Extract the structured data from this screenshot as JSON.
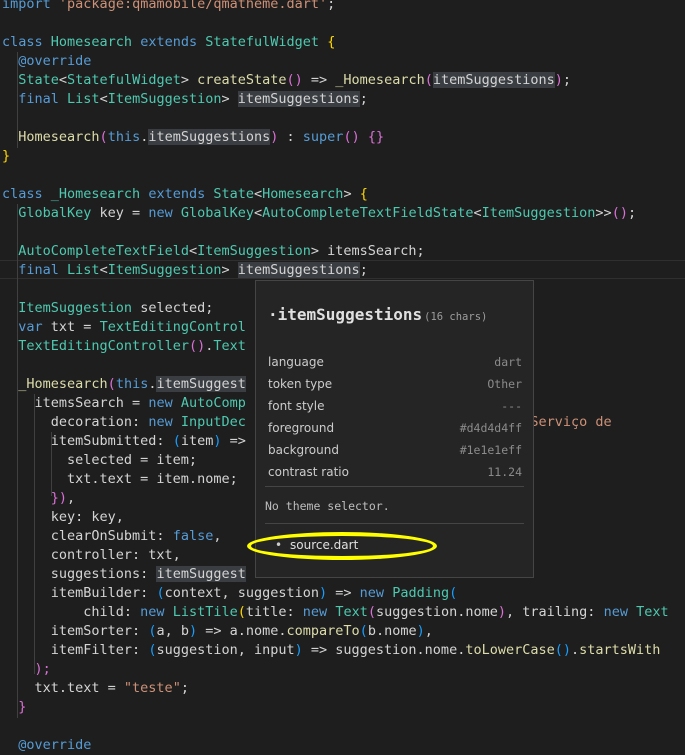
{
  "editor": {
    "lines": [
      [
        [
          "t-kw",
          "import"
        ],
        [
          "t-plain",
          " "
        ],
        [
          "t-str",
          "'package:qmamobile/qmatheme.dart'"
        ],
        [
          "t-plain",
          ";"
        ]
      ],
      [],
      [
        [
          "t-kw",
          "class"
        ],
        [
          "t-plain",
          " "
        ],
        [
          "t-cls",
          "Homesearch"
        ],
        [
          "t-plain",
          " "
        ],
        [
          "t-kw",
          "extends"
        ],
        [
          "t-plain",
          " "
        ],
        [
          "t-cls",
          "StatefulWidget"
        ],
        [
          "t-plain",
          " "
        ],
        [
          "t-brk1",
          "{"
        ]
      ],
      [
        [
          "t-plain",
          "  "
        ],
        [
          "t-ann",
          "@override"
        ]
      ],
      [
        [
          "t-plain",
          "  "
        ],
        [
          "t-cls",
          "State"
        ],
        [
          "t-plain",
          "<"
        ],
        [
          "t-cls",
          "StatefulWidget"
        ],
        [
          "t-plain",
          "> "
        ],
        [
          "t-fn",
          "createState"
        ],
        [
          "t-brk2",
          "()"
        ],
        [
          "t-plain",
          " => "
        ],
        [
          "t-fn",
          "_Homesearch"
        ],
        [
          "t-brk2",
          "("
        ],
        [
          "hl",
          "itemSuggestions"
        ],
        [
          "t-brk2",
          ")"
        ],
        [
          "t-plain",
          ";"
        ]
      ],
      [
        [
          "t-plain",
          "  "
        ],
        [
          "t-kw",
          "final"
        ],
        [
          "t-plain",
          " "
        ],
        [
          "t-cls",
          "List"
        ],
        [
          "t-plain",
          "<"
        ],
        [
          "t-cls",
          "ItemSuggestion"
        ],
        [
          "t-plain",
          "> "
        ],
        [
          "hl",
          "itemSuggestions"
        ],
        [
          "t-plain",
          ";"
        ]
      ],
      [],
      [
        [
          "t-plain",
          "  "
        ],
        [
          "t-fn",
          "Homesearch"
        ],
        [
          "t-brk2",
          "("
        ],
        [
          "t-kw",
          "this"
        ],
        [
          "t-plain",
          "."
        ],
        [
          "hl",
          "itemSuggestions"
        ],
        [
          "t-brk2",
          ")"
        ],
        [
          "t-plain",
          " : "
        ],
        [
          "t-kw",
          "super"
        ],
        [
          "t-brk2",
          "()"
        ],
        [
          "t-plain",
          " "
        ],
        [
          "t-brk2",
          "{}"
        ]
      ],
      [
        [
          "t-brk1",
          "}"
        ]
      ],
      [],
      [
        [
          "t-kw",
          "class"
        ],
        [
          "t-plain",
          " "
        ],
        [
          "t-cls",
          "_Homesearch"
        ],
        [
          "t-plain",
          " "
        ],
        [
          "t-kw",
          "extends"
        ],
        [
          "t-plain",
          " "
        ],
        [
          "t-cls",
          "State"
        ],
        [
          "t-plain",
          "<"
        ],
        [
          "t-cls",
          "Homesearch"
        ],
        [
          "t-plain",
          "> "
        ],
        [
          "t-brk1",
          "{"
        ]
      ],
      [
        [
          "t-plain",
          "  "
        ],
        [
          "t-cls",
          "GlobalKey"
        ],
        [
          "t-plain",
          " key = "
        ],
        [
          "t-kw",
          "new"
        ],
        [
          "t-plain",
          " "
        ],
        [
          "t-cls",
          "GlobalKey"
        ],
        [
          "t-plain",
          "<"
        ],
        [
          "t-cls",
          "AutoCompleteTextFieldState"
        ],
        [
          "t-plain",
          "<"
        ],
        [
          "t-cls",
          "ItemSuggestion"
        ],
        [
          "t-plain",
          ">>"
        ],
        [
          "t-brk2",
          "()"
        ],
        [
          "t-plain",
          ";"
        ]
      ],
      [],
      [
        [
          "t-plain",
          "  "
        ],
        [
          "t-cls",
          "AutoCompleteTextField"
        ],
        [
          "t-plain",
          "<"
        ],
        [
          "t-cls",
          "ItemSuggestion"
        ],
        [
          "t-plain",
          "> itemsSearch;"
        ]
      ],
      [
        [
          "t-plain",
          "  "
        ],
        [
          "t-kw",
          "final"
        ],
        [
          "t-plain",
          " "
        ],
        [
          "t-cls",
          "List"
        ],
        [
          "t-plain",
          "<"
        ],
        [
          "t-cls",
          "ItemSuggestion"
        ],
        [
          "t-plain",
          "> "
        ],
        [
          "hl",
          "itemSuggestions"
        ],
        [
          "t-plain",
          ";"
        ]
      ],
      [],
      [
        [
          "t-plain",
          "  "
        ],
        [
          "t-cls",
          "ItemSuggestion"
        ],
        [
          "t-plain",
          " selected;"
        ]
      ],
      [
        [
          "t-plain",
          "  "
        ],
        [
          "t-kw",
          "var"
        ],
        [
          "t-plain",
          " txt = "
        ],
        [
          "t-cls",
          "TextEditingControl"
        ]
      ],
      [
        [
          "t-plain",
          "  "
        ],
        [
          "t-cls",
          "TextEditingController"
        ],
        [
          "t-brk2",
          "()"
        ],
        [
          "t-plain",
          "."
        ],
        [
          "t-cls",
          "Text"
        ]
      ],
      [],
      [
        [
          "t-plain",
          "  "
        ],
        [
          "t-fn",
          "_Homesearch"
        ],
        [
          "t-brk2",
          "("
        ],
        [
          "t-kw",
          "this"
        ],
        [
          "t-plain",
          "."
        ],
        [
          "hl",
          "itemSuggest"
        ]
      ],
      [
        [
          "t-plain",
          "    itemsSearch = "
        ],
        [
          "t-kw",
          "new"
        ],
        [
          "t-plain",
          " "
        ],
        [
          "t-cls",
          "AutoComp"
        ]
      ],
      [
        [
          "t-plain",
          "      decoration: "
        ],
        [
          "t-kw",
          "new"
        ],
        [
          "t-plain",
          " "
        ],
        [
          "t-cls",
          "InputDec"
        ],
        [
          "t-plain",
          "                           "
        ],
        [
          "t-str",
          "duto ou Serviço de"
        ]
      ],
      [
        [
          "t-plain",
          "      itemSubmitted: "
        ],
        [
          "t-brk3",
          "("
        ],
        [
          "t-plain",
          "item"
        ],
        [
          "t-brk3",
          ")"
        ],
        [
          "t-plain",
          " =>"
        ]
      ],
      [
        [
          "t-plain",
          "        selected = item;"
        ]
      ],
      [
        [
          "t-plain",
          "        txt.text = item.nome;"
        ]
      ],
      [
        [
          "t-plain",
          "      "
        ],
        [
          "t-brk2",
          "})"
        ],
        [
          "t-plain",
          ","
        ]
      ],
      [
        [
          "t-plain",
          "      key: key,"
        ]
      ],
      [
        [
          "t-plain",
          "      clearOnSubmit: "
        ],
        [
          "t-bool",
          "false"
        ],
        [
          "t-plain",
          ","
        ]
      ],
      [
        [
          "t-plain",
          "      controller: txt,"
        ]
      ],
      [
        [
          "t-plain",
          "      suggestions: "
        ],
        [
          "hl",
          "itemSuggest"
        ]
      ],
      [
        [
          "t-plain",
          "      itemBuilder: "
        ],
        [
          "t-brk3",
          "("
        ],
        [
          "t-plain",
          "context, suggestion"
        ],
        [
          "t-brk3",
          ")"
        ],
        [
          "t-plain",
          " => "
        ],
        [
          "t-kw",
          "new"
        ],
        [
          "t-plain",
          " "
        ],
        [
          "t-cls",
          "Padding"
        ],
        [
          "t-brk3",
          "("
        ]
      ],
      [
        [
          "t-plain",
          "          child: "
        ],
        [
          "t-kw",
          "new"
        ],
        [
          "t-plain",
          " "
        ],
        [
          "t-cls",
          "ListTile"
        ],
        [
          "t-brk1",
          "("
        ],
        [
          "t-plain",
          "title: "
        ],
        [
          "t-kw",
          "new"
        ],
        [
          "t-plain",
          " "
        ],
        [
          "t-cls",
          "Text"
        ],
        [
          "t-brk2",
          "("
        ],
        [
          "t-plain",
          "suggestion.nome"
        ],
        [
          "t-brk2",
          ")"
        ],
        [
          "t-plain",
          ", trailing: "
        ],
        [
          "t-kw",
          "new"
        ],
        [
          "t-plain",
          " "
        ],
        [
          "t-cls",
          "Text"
        ]
      ],
      [
        [
          "t-plain",
          "      itemSorter: "
        ],
        [
          "t-brk3",
          "("
        ],
        [
          "t-plain",
          "a, b"
        ],
        [
          "t-brk3",
          ")"
        ],
        [
          "t-plain",
          " => a.nome."
        ],
        [
          "t-fn",
          "compareTo"
        ],
        [
          "t-brk3",
          "("
        ],
        [
          "t-plain",
          "b.nome"
        ],
        [
          "t-brk3",
          ")"
        ],
        [
          "t-plain",
          ","
        ]
      ],
      [
        [
          "t-plain",
          "      itemFilter: "
        ],
        [
          "t-brk3",
          "("
        ],
        [
          "t-plain",
          "suggestion, input"
        ],
        [
          "t-brk3",
          ")"
        ],
        [
          "t-plain",
          " => suggestion.nome."
        ],
        [
          "t-fn",
          "toLowerCase"
        ],
        [
          "t-brk3",
          "()"
        ],
        [
          "t-plain",
          "."
        ],
        [
          "t-fn",
          "startsWith"
        ]
      ],
      [
        [
          "t-plain",
          "    "
        ],
        [
          "t-brk2",
          ");"
        ]
      ],
      [
        [
          "t-plain",
          "    txt.text = "
        ],
        [
          "t-str",
          "\"teste\""
        ],
        [
          "t-plain",
          ";"
        ]
      ],
      [
        [
          "t-plain",
          "  "
        ],
        [
          "t-brk2",
          "}"
        ]
      ],
      [],
      [
        [
          "t-plain",
          "  "
        ],
        [
          "t-ann",
          "@override"
        ]
      ]
    ]
  },
  "hover": {
    "token": "·itemSuggestions",
    "chars": "(16 chars)",
    "props": [
      {
        "key": "language",
        "value": "dart"
      },
      {
        "key": "token type",
        "value": "Other"
      },
      {
        "key": "font style",
        "value": "---"
      },
      {
        "key": "foreground",
        "value": "#d4d4d4ff"
      },
      {
        "key": "background",
        "value": "#1e1e1eff"
      },
      {
        "key": "contrast ratio",
        "value": "11.24"
      }
    ],
    "no_selector": "No theme selector.",
    "scope": "source.dart"
  },
  "colors": {
    "editor_bg": "#1e1e1e",
    "highlight_ring": "#ffff00"
  }
}
